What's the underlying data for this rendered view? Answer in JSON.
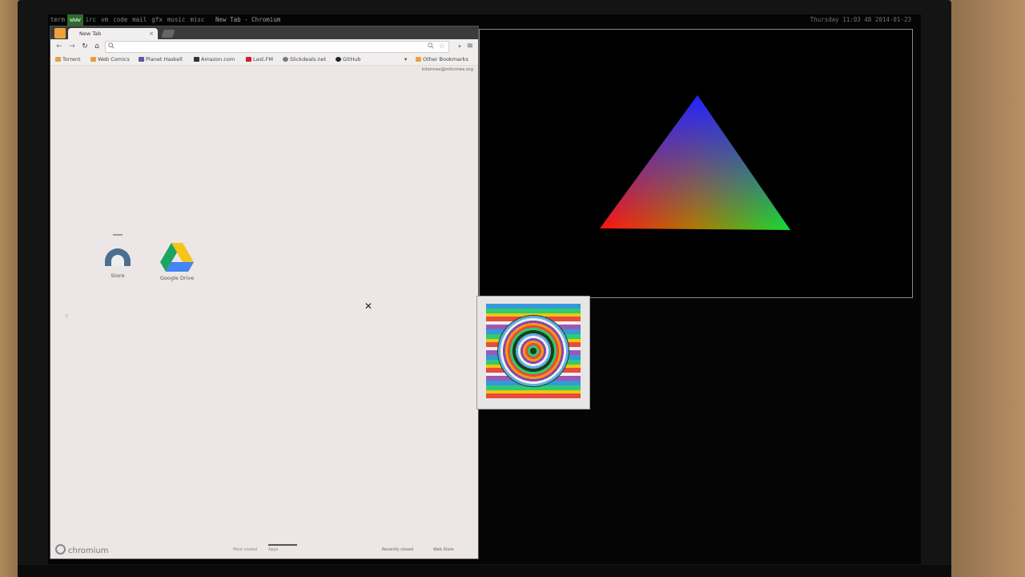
{
  "status_bar": {
    "workspaces": [
      "term",
      "www",
      "irc",
      "vm",
      "code",
      "mail",
      "gfx",
      "music",
      "misc"
    ],
    "active_workspace": "www",
    "window_title": "New Tab - Chromium",
    "clock": "Thursday 11:03 48 2014-01-23"
  },
  "browser": {
    "tab_title": "New Tab",
    "tab_close": "×",
    "nav": {
      "back": "←",
      "forward": "→",
      "reload": "↻",
      "home": "⌂"
    },
    "omnibox": {
      "value": "",
      "search_icon": "magnifier-icon",
      "star": "☆"
    },
    "menu": "≡",
    "bookmarks": [
      {
        "label": "Torrent",
        "icon_color": "#e2a24a"
      },
      {
        "label": "Web Comics",
        "icon_color": "#e2a24a"
      },
      {
        "label": "Planet Haskell",
        "icon_color": "#5b5b9a"
      },
      {
        "label": "Amazon.com",
        "icon_color": "#333333"
      },
      {
        "label": "Last.FM",
        "icon_color": "#d01f2f"
      },
      {
        "label": "Slickdeals.net",
        "icon_color": "#7a7a7a"
      },
      {
        "label": "GitHub",
        "icon_color": "#222222"
      }
    ],
    "other_bookmarks": "Other Bookmarks",
    "signin": "informes@informes.org",
    "apps": [
      {
        "label": "Store"
      },
      {
        "label": "Google Drive"
      }
    ],
    "footer": {
      "logo": "chromium",
      "pages": [
        "Most visited",
        "Apps"
      ],
      "active_page": "Apps",
      "recently_closed": "Recently closed",
      "web_store": "Web Store"
    }
  },
  "gl_window": {
    "triangle_colors": {
      "top": "#2222ff",
      "left": "#ff1111",
      "right": "#11dd33"
    }
  },
  "colors": {
    "active_ws": "#2d6a2d",
    "browser_bg": "#ede6e6"
  }
}
